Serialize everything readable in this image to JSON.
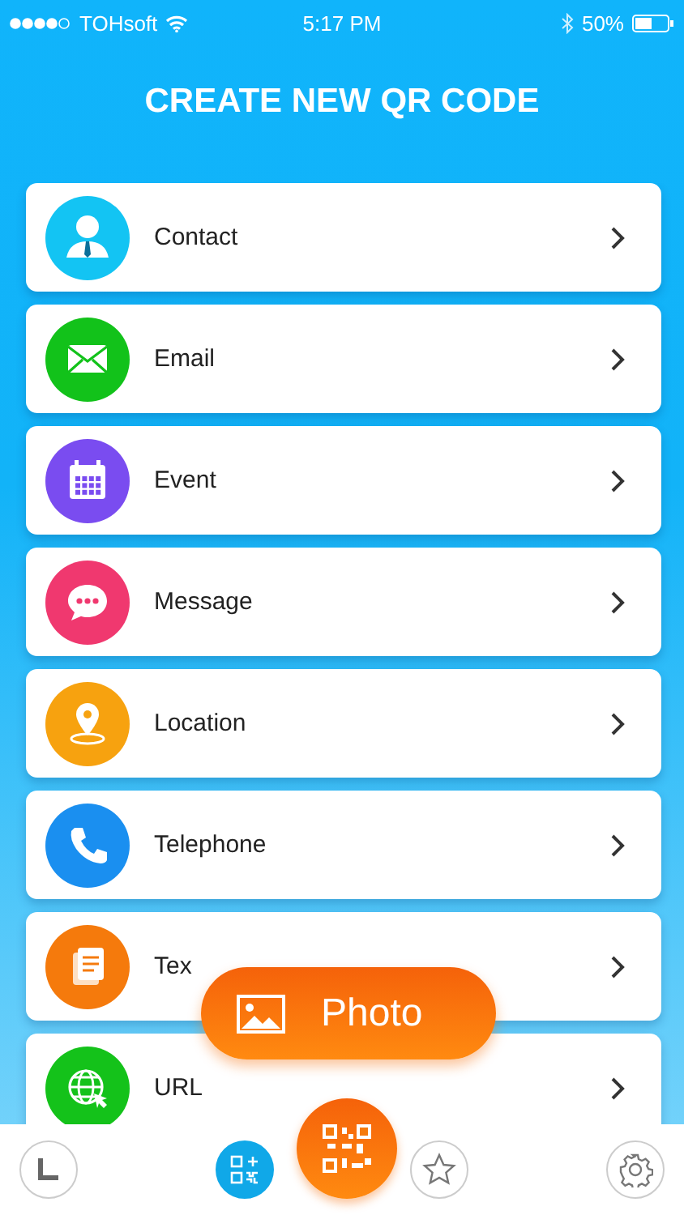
{
  "status_bar": {
    "carrier": "TOHsoft",
    "time": "5:17 PM",
    "battery": "50%"
  },
  "title": "CREATE NEW QR CODE",
  "items": [
    {
      "kind": "contact",
      "label": "Contact",
      "color": "#13c4f3"
    },
    {
      "kind": "email",
      "label": "Email",
      "color": "#12c21a"
    },
    {
      "kind": "event",
      "label": "Event",
      "color": "#7a4cf0"
    },
    {
      "kind": "message",
      "label": "Message",
      "color": "#f0386f"
    },
    {
      "kind": "location",
      "label": "Location",
      "color": "#f7a20f"
    },
    {
      "kind": "telephone",
      "label": "Telephone",
      "color": "#1a8ff0"
    },
    {
      "kind": "text",
      "label": "Tex",
      "color": "#f57a0c"
    },
    {
      "kind": "url",
      "label": "URL",
      "color": "#14c21a"
    }
  ],
  "photo_button": {
    "label": "Photo"
  },
  "tab_bar": [
    {
      "kind": "history",
      "selected": false
    },
    {
      "kind": "create",
      "selected": true
    },
    {
      "kind": "scan",
      "selected": false
    },
    {
      "kind": "favorites",
      "selected": false
    },
    {
      "kind": "settings",
      "selected": false
    }
  ]
}
